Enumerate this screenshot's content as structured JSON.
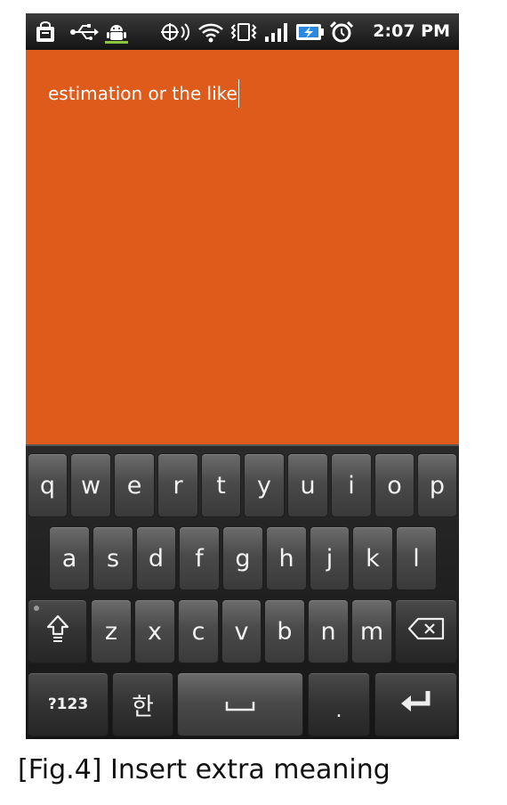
{
  "status_bar": {
    "time": "2:07 PM",
    "icons": [
      "bag-notification-icon",
      "usb-icon",
      "android-debug-icon",
      "gps-icon",
      "wifi-icon",
      "vibrate-icon",
      "signal-bars-icon",
      "battery-charging-icon",
      "alarm-icon"
    ]
  },
  "editor": {
    "text": "estimation or the like",
    "background": "#df5b1b"
  },
  "keyboard": {
    "row1": [
      "q",
      "w",
      "e",
      "r",
      "t",
      "y",
      "u",
      "i",
      "o",
      "p"
    ],
    "row2": [
      "a",
      "s",
      "d",
      "f",
      "g",
      "h",
      "j",
      "k",
      "l"
    ],
    "row3": [
      "z",
      "x",
      "c",
      "v",
      "b",
      "n",
      "m"
    ],
    "symbols_label": "?123",
    "language_label": "한",
    "period_label": ".",
    "shift_icon": "shift-icon",
    "backspace_icon": "backspace-icon",
    "space_icon": "space-icon",
    "enter_icon": "enter-icon"
  },
  "caption": "[Fig.4] Insert extra meaning"
}
